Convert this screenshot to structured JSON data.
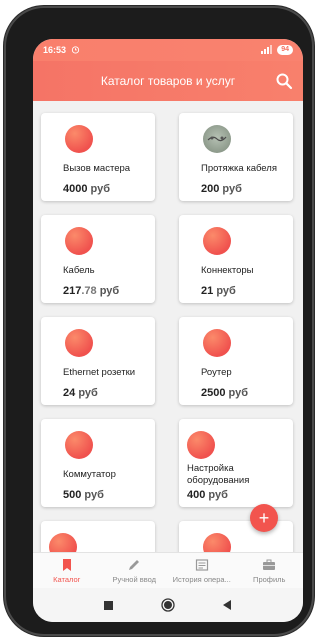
{
  "status": {
    "time": "16:53",
    "battery": "94"
  },
  "appbar": {
    "title": "Каталог товаров и услуг"
  },
  "items": [
    {
      "title": "Вызов мастера",
      "price_main": "4000",
      "price_frac": "",
      "unit": "руб"
    },
    {
      "title": "Протяжка кабеля",
      "price_main": "200",
      "price_frac": "",
      "unit": "руб"
    },
    {
      "title": "Кабель",
      "price_main": "217",
      "price_frac": ".78",
      "unit": "руб"
    },
    {
      "title": "Коннекторы",
      "price_main": "21",
      "price_frac": "",
      "unit": "руб"
    },
    {
      "title": "Ethernet розетки",
      "price_main": "24",
      "price_frac": "",
      "unit": "руб"
    },
    {
      "title": "Роутер",
      "price_main": "2500",
      "price_frac": "",
      "unit": "руб"
    },
    {
      "title": "Коммутатор",
      "price_main": "500",
      "price_frac": "",
      "unit": "руб"
    },
    {
      "title": "Настройка оборудования",
      "price_main": "400",
      "price_frac": "",
      "unit": "руб"
    }
  ],
  "fab": {
    "label": "+"
  },
  "nav": [
    {
      "label": "Каталог",
      "icon": "bookmark-icon"
    },
    {
      "label": "Ручной ввод",
      "icon": "pencil-icon"
    },
    {
      "label": "История опера...",
      "icon": "receipt-icon"
    },
    {
      "label": "Профиль",
      "icon": "briefcase-icon"
    }
  ],
  "colors": {
    "accent": "#f2544e",
    "appbar": "#f57466"
  }
}
